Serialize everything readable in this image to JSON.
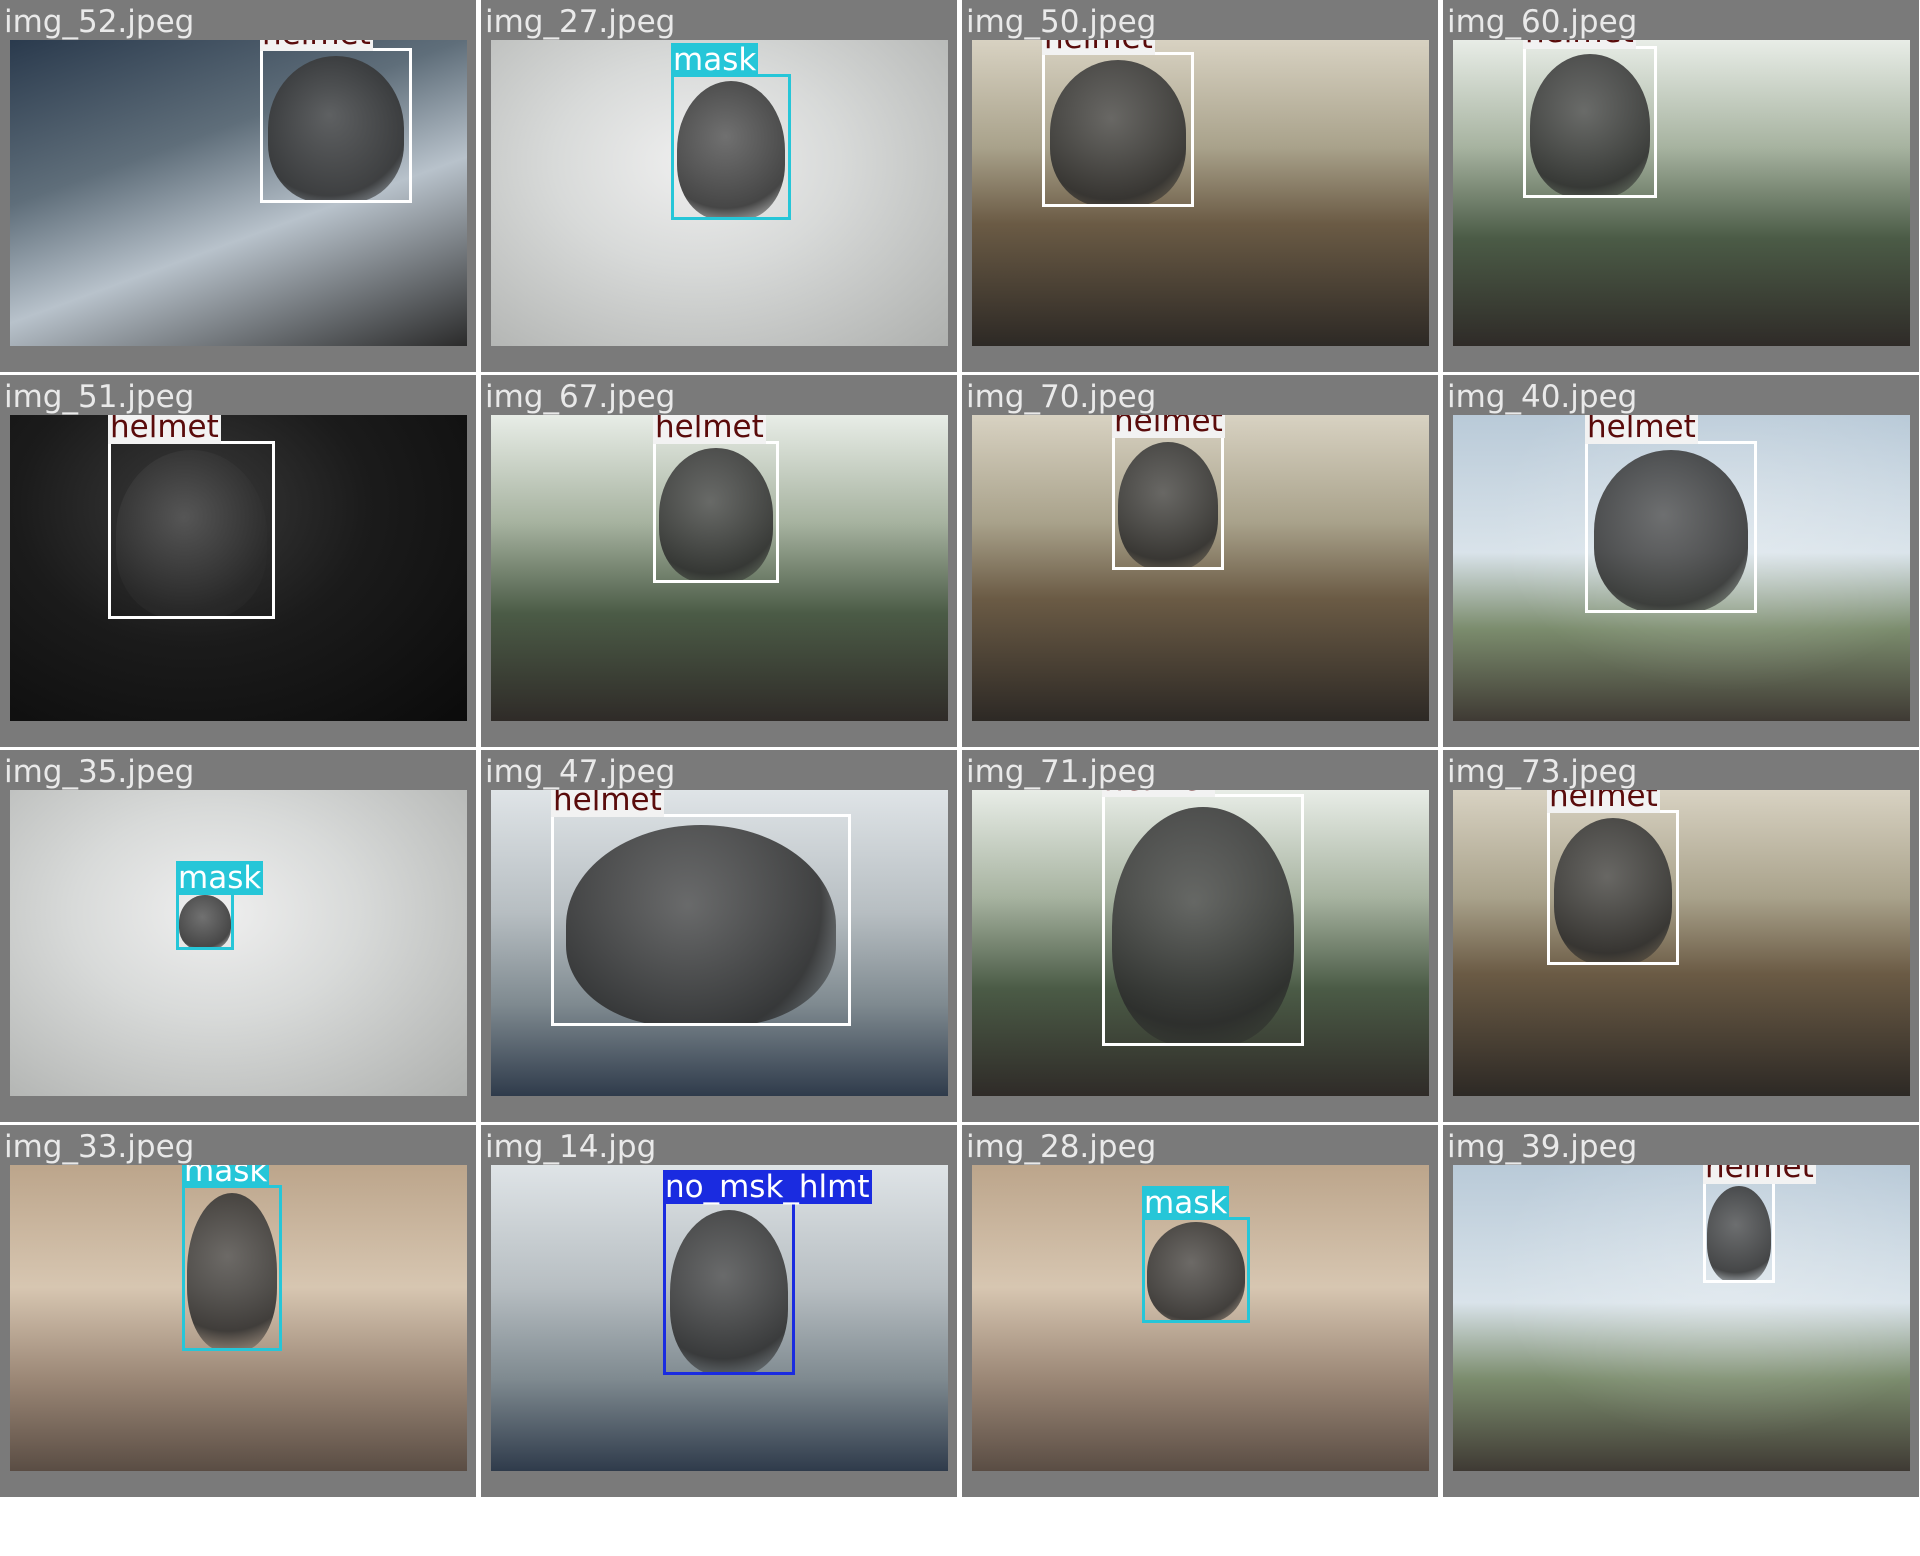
{
  "colors": {
    "helmet_box": "#ffffff",
    "helmet_label_bg": "#f2f2f2",
    "helmet_label_text": "#5a0b0b",
    "mask_box": "#26c6d8",
    "mask_label_bg": "#26c6d8",
    "mask_label_text": "#ffffff",
    "no_mask_no_helmet_box": "#1a2be0",
    "no_mask_no_helmet_label_bg": "#1a2be0",
    "no_mask_no_helmet_label_text": "#ffffff",
    "tile_background": "#7a7a7a",
    "filename_text": "#e9e9e9"
  },
  "tiles": [
    {
      "filename": "img_52.jpeg",
      "detections": [
        {
          "label": "helmet"
        }
      ]
    },
    {
      "filename": "img_27.jpeg",
      "detections": [
        {
          "label": "mask"
        }
      ]
    },
    {
      "filename": "img_50.jpeg",
      "detections": [
        {
          "label": "helmet"
        }
      ]
    },
    {
      "filename": "img_60.jpeg",
      "detections": [
        {
          "label": "helmet"
        }
      ]
    },
    {
      "filename": "img_51.jpeg",
      "detections": [
        {
          "label": "helmet"
        }
      ]
    },
    {
      "filename": "img_67.jpeg",
      "detections": [
        {
          "label": "helmet"
        }
      ]
    },
    {
      "filename": "img_70.jpeg",
      "detections": [
        {
          "label": "helmet"
        }
      ]
    },
    {
      "filename": "img_40.jpeg",
      "detections": [
        {
          "label": "helmet"
        }
      ]
    },
    {
      "filename": "img_35.jpeg",
      "detections": [
        {
          "label": "mask"
        }
      ]
    },
    {
      "filename": "img_47.jpeg",
      "detections": [
        {
          "label": "helmet"
        }
      ]
    },
    {
      "filename": "img_71.jpeg",
      "detections": [
        {
          "label": "helmet"
        }
      ]
    },
    {
      "filename": "img_73.jpeg",
      "detections": [
        {
          "label": "helmet"
        }
      ]
    },
    {
      "filename": "img_33.jpeg",
      "detections": [
        {
          "label": "mask"
        }
      ]
    },
    {
      "filename": "img_14.jpg",
      "detections": [
        {
          "label": "no_msk_hlmt"
        }
      ]
    },
    {
      "filename": "img_28.jpeg",
      "detections": [
        {
          "label": "mask"
        }
      ]
    },
    {
      "filename": "img_39.jpeg",
      "detections": [
        {
          "label": "helmet"
        }
      ]
    }
  ]
}
